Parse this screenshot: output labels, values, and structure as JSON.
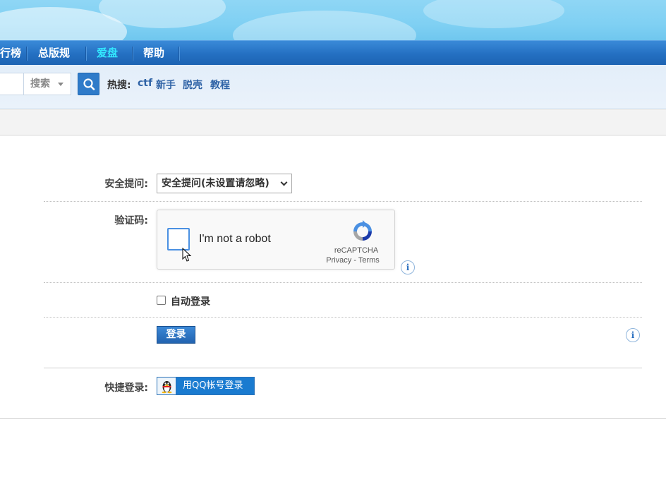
{
  "nav": {
    "items": [
      {
        "label": "行榜",
        "color": "#ffffff"
      },
      {
        "label": "总版规",
        "color": "#ffffff"
      },
      {
        "label": "爱盘",
        "color": "#33e8ff"
      },
      {
        "label": "帮助",
        "color": "#ffffff"
      }
    ]
  },
  "search": {
    "type_label": "搜索",
    "hot_label": "热搜:",
    "hot_links": [
      "ctf",
      "新手",
      "脱壳",
      "教程"
    ]
  },
  "form": {
    "security_question_label": "安全提问:",
    "security_question_value": "安全提问(未设置请忽略)",
    "captcha_label": "验证码:",
    "recaptcha": {
      "text": "I'm not a robot",
      "brand": "reCAPTCHA",
      "privacy": "Privacy",
      "separator": " - ",
      "terms": "Terms"
    },
    "auto_login_label": "自动登录",
    "login_button": "登录",
    "quick_login_label": "快捷登录:",
    "qq_login_button": "用QQ帐号登录"
  },
  "icons": {
    "info": "i"
  },
  "colors": {
    "nav_bg": "#2470c2",
    "link": "#2f63a6",
    "recaptcha_box": "#4a90e2"
  }
}
